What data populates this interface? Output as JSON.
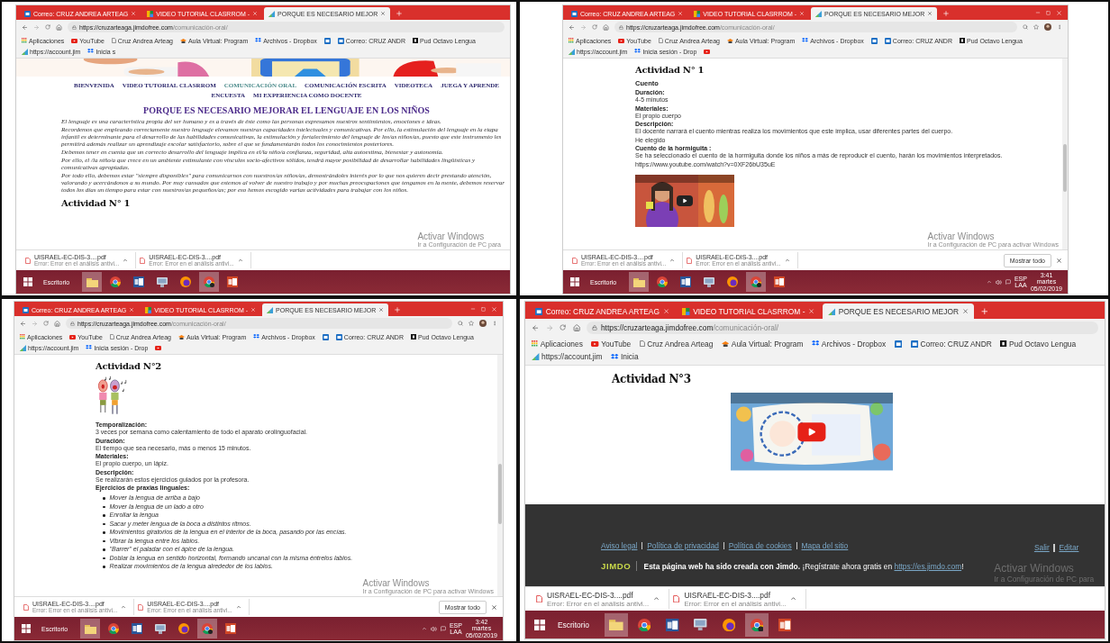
{
  "panels": [
    {
      "tabs": [
        {
          "label": "Correo: CRUZ ANDREA ARTEAG",
          "kind": "outlook",
          "selected": false
        },
        {
          "label": "VIDEO TUTORIAL CLASRROM - ",
          "kind": "classroom",
          "selected": false
        },
        {
          "label": "PORQUE ES NECESARIO MEJOR",
          "kind": "jimdo",
          "selected": true
        }
      ],
      "window_controls": false,
      "address": {
        "host": "https://cruzarteaga.jimdofree.com",
        "path": "/comunicación-oral/"
      },
      "address_tools": false,
      "bookmarks": [
        {
          "label": "Aplicaciones",
          "kind": "apps"
        },
        {
          "label": "YouTube",
          "kind": "youtube"
        },
        {
          "label": "Cruz Andrea Arteag",
          "kind": "page"
        },
        {
          "label": "Aula Virtual: Program",
          "kind": "moodle"
        },
        {
          "label": "Archivos - Dropbox",
          "kind": "dropbox"
        },
        {
          "kind": "outlook"
        },
        {
          "label": "Correo: CRUZ ANDR",
          "kind": "outlook"
        },
        {
          "label": "Pud Octavo Lengua",
          "kind": "pud"
        },
        {
          "label": "https://account.jim",
          "kind": "jimdo"
        },
        {
          "label": "Inicia s",
          "kind": "dropbox"
        }
      ],
      "content": [
        {
          "kind": "banner"
        },
        {
          "kind": "nav",
          "items": [
            {
              "label": "BIENVENIDA",
              "selected": false
            },
            {
              "label": "VIDEO TUTORIAL CLASRROM",
              "selected": false
            },
            {
              "label": "COMUNICACIÓN ORAL",
              "selected": true
            },
            {
              "label": "COMUNICACIÓN ESCRITA",
              "selected": false
            },
            {
              "label": "VIDEOTECA",
              "selected": false
            },
            {
              "label": "JUEGA Y APRENDE",
              "selected": false
            },
            {
              "label": "ENCUESTA",
              "selected": false
            },
            {
              "label": "MI EXPERIENCIA COMO DOCENTE",
              "selected": false
            }
          ]
        },
        {
          "kind": "heading",
          "text": "PORQUE ES NECESARIO MEJORAR EL LENGUAJE EN LOS NIÑOS"
        },
        {
          "kind": "paragraphs",
          "items": [
            "El lenguaje es una característica propia del ser humano y es a través de éste como las personas expresamos nuestros sentimientos, emociones e ideas.",
            "Recordemos que empleando correctamente nuestro lenguaje elevamos nuestras capacidades intelectuales y comunicativas. Por ello, la estimulación del lenguaje en la etapa infantil es determinante para el desarrollo de las habilidades comunicativas, la estimulación y fortalecimiento del lenguaje de los/as niños/as, puesto que este instrumento les permitirá además realizar un aprendizaje escolar satisfactorio, sobre el que se fundamentarán todos los conocimientos posteriores.",
            "Debemos tener en cuenta que un correcto desarrollo del lenguaje implica en el/la niño/a confianza, seguridad, alta autoestima, bienestar y autonomía.",
            "Por ello, el /la niño/a que crece en un ambiente estimulante con vínculos socio-afectivos sólidos, tendrá mayor posibilidad de desarrollar habilidades lingüísticas y comunicativas apropiadas.",
            "Por todo ello, debemos estar \"siempre disponibles\" para comunicarnos con nuestros/as niños/as, demostrándoles interés por lo que nos quieren decir prestando atención, valorando y acercándonos a su mundo. Por muy cansados que estemos al volver de nuestro trabajo y por muchas preocupaciones que tengamos en la mente, debemos reservar todos los días un tiempo para estar con nuestros/as pequeños/as; por eso hemos escogido varias actividades para trabajar con los niños."
          ]
        },
        {
          "kind": "activity",
          "text": "Actividad N° 1"
        }
      ],
      "scrollbar": false,
      "downloads": [
        {
          "name": "UISRAEL-EC-DIS-3....pdf",
          "status": "Error: Error en el análisis antivi..."
        },
        {
          "name": "UISRAEL-EC-DIS-3....pdf",
          "status": "Error: Error en el análisis antivi..."
        }
      ],
      "taskbar": {
        "start_label": "Escritorio",
        "apps": [
          {
            "kind": "folder",
            "active": true
          },
          {
            "kind": "chrome",
            "active": false
          },
          {
            "kind": "word",
            "active": false
          },
          {
            "kind": "monitor",
            "active": false
          },
          {
            "kind": "firefox",
            "active": false
          },
          {
            "kind": "chrome_profile",
            "active": true
          },
          {
            "kind": "powerpoint",
            "active": false
          }
        ]
      },
      "activation": {
        "title": "Activar Windows",
        "subtitle": "Ir a Configuración de PC para"
      }
    },
    {
      "tabs": [
        {
          "label": "Correo: CRUZ ANDREA ARTEAG",
          "kind": "outlook",
          "selected": false
        },
        {
          "label": "VIDEO TUTORIAL CLASRROM - ",
          "kind": "classroom",
          "selected": false
        },
        {
          "label": "PORQUE ES NECESARIO MEJOR",
          "kind": "jimdo",
          "selected": true
        }
      ],
      "window_controls": true,
      "address": {
        "host": "https://cruzarteaga.jimdofree.com",
        "path": "/comunicación-oral/"
      },
      "address_tools": true,
      "bookmarks": [
        {
          "label": "Aplicaciones",
          "kind": "apps"
        },
        {
          "label": "YouTube",
          "kind": "youtube"
        },
        {
          "label": "Cruz Andrea Arteag",
          "kind": "page"
        },
        {
          "label": "Aula Virtual: Program",
          "kind": "moodle"
        },
        {
          "label": "Archivos - Dropbox",
          "kind": "dropbox"
        },
        {
          "kind": "outlook"
        },
        {
          "label": "Correo: CRUZ ANDR",
          "kind": "outlook"
        },
        {
          "label": "Pud Octavo Lengua",
          "kind": "pud"
        },
        {
          "label": "https://account.jim",
          "kind": "jimdo"
        },
        {
          "label": "Inicia sesión - Drop",
          "kind": "dropbox"
        },
        {
          "kind": "youtube"
        }
      ],
      "content": [
        {
          "kind": "activity",
          "text": "Actividad N° 1"
        },
        {
          "kind": "subheading",
          "text": "Cuento"
        },
        {
          "kind": "label",
          "text": "Duración:"
        },
        {
          "kind": "text",
          "text": "4-5 minutos"
        },
        {
          "kind": "label",
          "text": "Materiales:"
        },
        {
          "kind": "text",
          "text": "El propio cuerpo"
        },
        {
          "kind": "label",
          "text": "Descripción:"
        },
        {
          "kind": "text",
          "text": "El docente narrará el cuento mientras realiza los movimientos que este implica, usar diferentes partes del cuerpo."
        },
        {
          "kind": "text",
          "text": "He elegido"
        },
        {
          "kind": "label",
          "text": "Cuento de la hormiguita :"
        },
        {
          "kind": "text",
          "text": "Se ha seleccionado el cuento de la hormiguita donde los niños a más de reproducir el cuento, harán los movimientos interpretados."
        },
        {
          "kind": "text",
          "text": "https://www.youtube.com/watch?v=0XF26bU35uE"
        },
        {
          "kind": "video"
        }
      ],
      "scrollbar": true,
      "downloads": [
        {
          "name": "UISRAEL-EC-DIS-3....pdf",
          "status": "Error: Error en el análisis antivi..."
        },
        {
          "name": "UISRAEL-EC-DIS-3....pdf",
          "status": "Error: Error en el análisis antivi..."
        }
      ],
      "show_all": "Mostrar todo",
      "taskbar": {
        "start_label": "Escritorio",
        "apps": [
          {
            "kind": "folder",
            "active": true
          },
          {
            "kind": "chrome",
            "active": false
          },
          {
            "kind": "word",
            "active": false
          },
          {
            "kind": "monitor",
            "active": false
          },
          {
            "kind": "firefox",
            "active": false
          },
          {
            "kind": "chrome_profile",
            "active": true
          },
          {
            "kind": "powerpoint",
            "active": false
          }
        ],
        "tray": {
          "lang": "ESP",
          "region": "LAA",
          "time": "3:41",
          "day": "martes",
          "date": "05/02/2019"
        }
      },
      "activation": {
        "title": "Activar Windows",
        "subtitle": "Ir a Configuración de PC para activar Windows"
      }
    },
    {
      "tabs": [
        {
          "label": "Correo: CRUZ ANDREA ARTEAG",
          "kind": "outlook",
          "selected": false
        },
        {
          "label": "VIDEO TUTORIAL CLASRROM - ",
          "kind": "classroom",
          "selected": false
        },
        {
          "label": "PORQUE ES NECESARIO MEJOR",
          "kind": "jimdo",
          "selected": true
        }
      ],
      "window_controls": true,
      "address": {
        "host": "https://cruzarteaga.jimdofree.com",
        "path": "/comunicación-oral/"
      },
      "address_tools": true,
      "bookmarks": [
        {
          "label": "Aplicaciones",
          "kind": "apps"
        },
        {
          "label": "YouTube",
          "kind": "youtube"
        },
        {
          "label": "Cruz Andrea Arteag",
          "kind": "page"
        },
        {
          "label": "Aula Virtual: Program",
          "kind": "moodle"
        },
        {
          "label": "Archivos - Dropbox",
          "kind": "dropbox"
        },
        {
          "kind": "outlook"
        },
        {
          "label": "Correo: CRUZ ANDR",
          "kind": "outlook"
        },
        {
          "label": "Pud Octavo Lengua",
          "kind": "pud"
        },
        {
          "label": "https://account.jim",
          "kind": "jimdo"
        },
        {
          "label": "Inicia sesión - Drop",
          "kind": "dropbox"
        },
        {
          "kind": "youtube"
        }
      ],
      "content": [
        {
          "kind": "activity",
          "text": "Actividad N°2"
        },
        {
          "kind": "illustration"
        },
        {
          "kind": "label",
          "text": "Temporalización:"
        },
        {
          "kind": "text",
          "text": "3 veces por semana como calentamiento de todo el aparato orolinguofacial."
        },
        {
          "kind": "label",
          "text": "Duración:"
        },
        {
          "kind": "text",
          "text": "El tiempo que sea necesario, más o menos 15 minutos."
        },
        {
          "kind": "label",
          "text": "Materiales:"
        },
        {
          "kind": "text",
          "text": "El propio cuerpo, un lápiz."
        },
        {
          "kind": "label",
          "text": "Descripción:"
        },
        {
          "kind": "text",
          "text": "Se realizarán estos ejercicios guiados por la profesora."
        },
        {
          "kind": "label",
          "text": "Ejercicios de praxias linguales:"
        },
        {
          "kind": "bullets",
          "items": [
            "Mover la lengua de arriba a bajo",
            "Mover la lengua de un lado a otro",
            "Enrollar la lengua",
            "Sacar y meter lengua de la boca a distintos ritmos.",
            "Movimientos giratorios de la lengua en el interior de la boca, pasando por las encías.",
            "Vibrar la lengua entre los labios.",
            "\"Barrer\" el paladar con el ápice de la lengua.",
            "Doblar la lengua en sentido horizontal, formando uncanal con la misma éntrelos labios.",
            "Realizar movimientos de la lengua alrededor de los labios."
          ]
        }
      ],
      "scrollbar": true,
      "downloads": [
        {
          "name": "UISRAEL-EC-DIS-3....pdf",
          "status": "Error: Error en el análisis antivi..."
        },
        {
          "name": "UISRAEL-EC-DIS-3....pdf",
          "status": "Error: Error en el análisis antivi..."
        }
      ],
      "show_all": "Mostrar todo",
      "taskbar": {
        "start_label": "Escritorio",
        "apps": [
          {
            "kind": "folder",
            "active": true
          },
          {
            "kind": "chrome",
            "active": false
          },
          {
            "kind": "word",
            "active": false
          },
          {
            "kind": "monitor",
            "active": false
          },
          {
            "kind": "firefox",
            "active": false
          },
          {
            "kind": "chrome_profile",
            "active": true
          },
          {
            "kind": "powerpoint",
            "active": false
          }
        ],
        "tray": {
          "lang": "ESP",
          "region": "LAA",
          "time": "3:42",
          "day": "martes",
          "date": "05/02/2019"
        }
      },
      "activation": {
        "title": "Activar Windows",
        "subtitle": "Ir a Configuración de PC para activar Windows"
      }
    },
    {
      "tabs": [
        {
          "label": "Correo: CRUZ ANDREA ARTEAG",
          "kind": "outlook",
          "selected": false
        },
        {
          "label": "VIDEO TUTORIAL CLASRROM - ",
          "kind": "classroom",
          "selected": false
        },
        {
          "label": "PORQUE ES NECESARIO MEJOR",
          "kind": "jimdo",
          "selected": true
        }
      ],
      "window_controls": false,
      "address": {
        "host": "https://cruzarteaga.jimdofree.com",
        "path": "/comunicación-oral/"
      },
      "address_tools": false,
      "bookmarks": [
        {
          "label": "Aplicaciones",
          "kind": "apps"
        },
        {
          "label": "YouTube",
          "kind": "youtube"
        },
        {
          "label": "Cruz Andrea Arteag",
          "kind": "page"
        },
        {
          "label": "Aula Virtual: Program",
          "kind": "moodle"
        },
        {
          "label": "Archivos - Dropbox",
          "kind": "dropbox"
        },
        {
          "kind": "outlook"
        },
        {
          "label": "Correo: CRUZ ANDR",
          "kind": "outlook"
        },
        {
          "label": "Pud Octavo Lengua",
          "kind": "pud"
        },
        {
          "label": "https://account.jim",
          "kind": "jimdo"
        },
        {
          "label": "Inicia",
          "kind": "dropbox"
        }
      ],
      "content": [
        {
          "kind": "activity",
          "text": "Actividad N°3"
        },
        {
          "kind": "video"
        },
        {
          "kind": "footer",
          "links": [
            "Aviso legal",
            "Política de privacidad",
            "Política de cookies",
            "Mapa del sitio"
          ],
          "account_links": [
            "Salir",
            "Editar"
          ],
          "logo": "JIMDO",
          "note": "**Esta página web ha sido creada con Jimdo.** ¡Regístrate ahora gratis en",
          "note_link": "https://es.jimdo.com",
          "note_end": "!"
        }
      ],
      "scrollbar": false,
      "downloads": [
        {
          "name": "UISRAEL-EC-DIS-3....pdf",
          "status": "Error: Error en el análisis antivi..."
        },
        {
          "name": "UISRAEL-EC-DIS-3....pdf",
          "status": "Error: Error en el análisis antivi..."
        }
      ],
      "taskbar": {
        "start_label": "Escritorio",
        "apps": [
          {
            "kind": "folder",
            "active": true
          },
          {
            "kind": "chrome",
            "active": false
          },
          {
            "kind": "word",
            "active": false
          },
          {
            "kind": "monitor",
            "active": false
          },
          {
            "kind": "firefox",
            "active": false
          },
          {
            "kind": "chrome_profile",
            "active": true
          },
          {
            "kind": "powerpoint",
            "active": false
          }
        ]
      },
      "activation": {
        "title": "Activar Windows",
        "subtitle": "Ir a Configuración de PC para"
      }
    }
  ]
}
